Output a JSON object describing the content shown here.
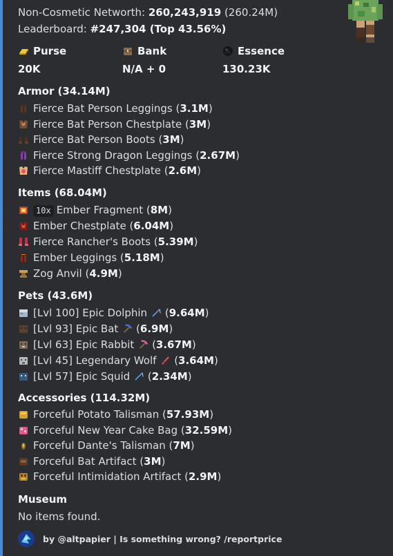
{
  "header": {
    "networth_label": "Non-Cosmetic Networth: ",
    "networth_value": "260,243,919",
    "networth_short": " (260.24M)",
    "leaderboard_label": "Leaderboard: ",
    "leaderboard_rank": "#247,304",
    "leaderboard_top": " (Top 43.56%)"
  },
  "stats": {
    "purse": {
      "label": "Purse",
      "value": "20K",
      "icon": "gold-ingot-icon"
    },
    "bank": {
      "label": "Bank",
      "value": "N/A + 0",
      "icon": "chest-icon"
    },
    "essence": {
      "label": "Essence",
      "value": "130.23K",
      "icon": "wither-essence-icon"
    }
  },
  "armor": {
    "heading": "Armor (34.14M)",
    "items": [
      {
        "name": "Fierce Bat Person Leggings",
        "value": "3.1M",
        "icon": "leggings-icon"
      },
      {
        "name": "Fierce Bat Person Chestplate",
        "value": "3M",
        "icon": "chestplate-icon"
      },
      {
        "name": "Fierce Bat Person Boots",
        "value": "3M",
        "icon": "boots-icon"
      },
      {
        "name": "Fierce Strong Dragon Leggings",
        "value": "2.67M",
        "icon": "dragon-leggings-icon"
      },
      {
        "name": "Fierce Mastiff Chestplate",
        "value": "2.6M",
        "icon": "mastiff-chestplate-icon"
      }
    ]
  },
  "items": {
    "heading": "Items (68.04M)",
    "list": [
      {
        "count": "10x",
        "name": "Ember Fragment",
        "value": "8M",
        "icon": "ember-fragment-icon"
      },
      {
        "count": "",
        "name": "Ember Chestplate",
        "value": "6.04M",
        "icon": "ember-chestplate-icon"
      },
      {
        "count": "",
        "name": "Fierce Rancher's Boots",
        "value": "5.39M",
        "icon": "rancher-boots-icon"
      },
      {
        "count": "",
        "name": "Ember Leggings",
        "value": "5.18M",
        "icon": "ember-leggings-icon"
      },
      {
        "count": "",
        "name": "Zog Anvil",
        "value": "4.9M",
        "icon": "anvil-icon"
      }
    ]
  },
  "pets": {
    "heading": "Pets (43.6M)",
    "list": [
      {
        "name": "[Lvl 100] Epic Dolphin",
        "value": "9.64M",
        "icon": "dolphin-icon",
        "tool": "rod-icon",
        "tool_color": "#5a8fd6"
      },
      {
        "name": "[Lvl 93] Epic Bat",
        "value": "6.9M",
        "icon": "bat-icon",
        "tool": "pickaxe-icon",
        "tool_color": "#4f6fd8"
      },
      {
        "name": "[Lvl 63] Epic Rabbit",
        "value": "3.67M",
        "icon": "rabbit-icon",
        "tool": "pickaxe-icon",
        "tool_color": "#d86aa2"
      },
      {
        "name": "[Lvl 45] Legendary Wolf",
        "value": "3.64M",
        "icon": "wolf-icon",
        "tool": "sword-icon",
        "tool_color": "#e0455c"
      },
      {
        "name": "[Lvl 57] Epic Squid",
        "value": "2.34M",
        "icon": "squid-icon",
        "tool": "rod-icon",
        "tool_color": "#5a8fd6"
      }
    ]
  },
  "accessories": {
    "heading": "Accessories (114.32M)",
    "list": [
      {
        "name": "Forceful Potato Talisman",
        "value": "57.93M",
        "icon": "potato-talisman-icon"
      },
      {
        "name": "Forceful New Year Cake Bag",
        "value": "32.59M",
        "icon": "cake-bag-icon"
      },
      {
        "name": "Forceful Dante's Talisman",
        "value": "7M",
        "icon": "dante-talisman-icon"
      },
      {
        "name": "Forceful Bat Artifact",
        "value": "3M",
        "icon": "bat-artifact-icon"
      },
      {
        "name": "Forceful Intimidation Artifact",
        "value": "2.9M",
        "icon": "intimidation-artifact-icon"
      }
    ]
  },
  "museum": {
    "heading": "Museum",
    "text": "No items found."
  },
  "footer": {
    "text": "by @altpapier | Is something wrong? /reportprice"
  },
  "colors": {
    "background": "#2b2d31",
    "accent_bar": "#4a8bd1",
    "text": "#dbdee1",
    "bold_text": "#f2f3f5"
  }
}
